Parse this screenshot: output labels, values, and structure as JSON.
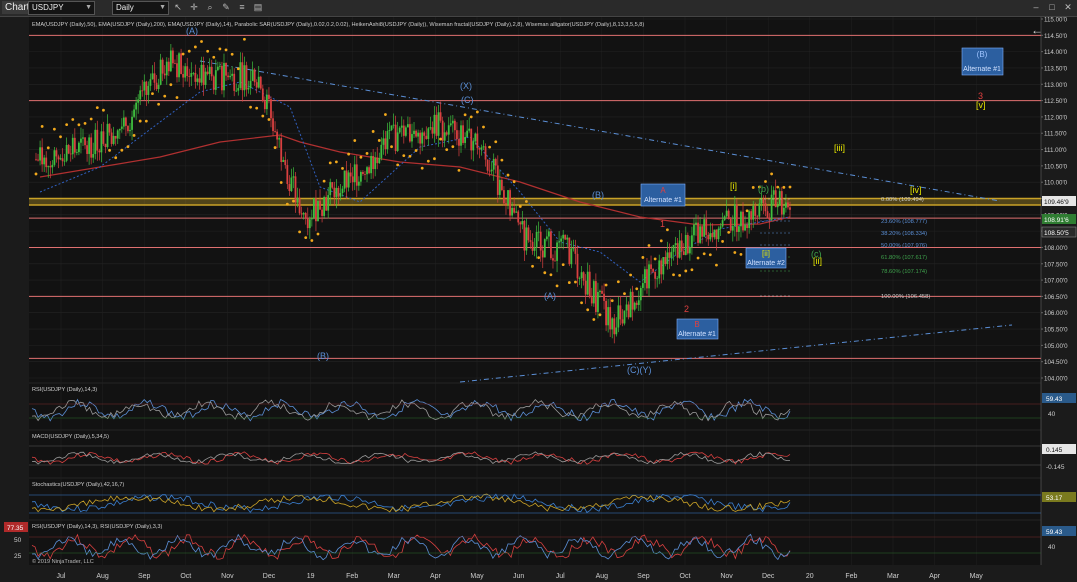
{
  "window": {
    "tab_label": "Chart",
    "instrument": "USDJPY",
    "timeframe": "Daily",
    "icons": [
      "chevron-down-icon",
      "chevron-down-icon",
      "cursor-icon",
      "crosshair-icon",
      "zoom-icon",
      "drawing-icon",
      "properties-icon",
      "strategy-icon",
      "window-minimize-icon",
      "window-maximize-icon",
      "close-icon"
    ],
    "back_arrow": "←",
    "copyright": "© 2019 NinjaTrader, LLC"
  },
  "indicator_legend": "EMA(USDJPY (Daily),50), EMA(USDJPY (Daily),200), EMA(USDJPY (Daily),14), Parabolic SAR(USDJPY (Daily),0.02,0.2,0.02), HeikenAshi8(USDJPY (Daily)), Wiseman fractal(USDJPY (Daily),2,8), Wiseman alligator(USDJPY (Daily),8,13,3,5,5,8)",
  "price_axis": {
    "ticks": [
      "115.00'0",
      "114.50'0",
      "114.00'0",
      "113.50'0",
      "113.00'0",
      "112.50'0",
      "112.00'0",
      "111.50'0",
      "111.00'0",
      "110.50'0",
      "110.00'0",
      "109.50'0",
      "109.00'0",
      "108.50'0",
      "108.00'0",
      "107.50'0",
      "107.00'0",
      "106.50'0",
      "106.00'0",
      "105.50'0",
      "105.00'0",
      "104.50'0",
      "104.00'0"
    ],
    "price_box": "109.46'9",
    "box_1": "108.91'6",
    "box_2": "108.50'5"
  },
  "time_axis": [
    "Jul",
    "Aug",
    "Sep",
    "Oct",
    "Nov",
    "Dec",
    "19",
    "Feb",
    "Mar",
    "Apr",
    "May",
    "Jun",
    "Jul",
    "Aug",
    "Sep",
    "Oct",
    "Nov",
    "Dec",
    "20",
    "Feb",
    "Mar",
    "Apr",
    "May"
  ],
  "fib_levels": [
    {
      "label": "0.00% (109.494)",
      "color": "#cccccc"
    },
    {
      "label": "23.60% (108.777)",
      "color": "#5b8fd6"
    },
    {
      "label": "38.20% (108.334)",
      "color": "#5b8fd6"
    },
    {
      "label": "50.00% (107.976)",
      "color": "#5b8fd6"
    },
    {
      "label": "61.80% (107.617)",
      "color": "#3fa34d"
    },
    {
      "label": "78.60% (107.174)",
      "color": "#3fa34d"
    },
    {
      "label": "100.00% (106.458)",
      "color": "#cccccc"
    }
  ],
  "wave_labels": {
    "A_top": "(A)",
    "X": "(X)",
    "C": "(C)",
    "B_low": "(B)",
    "B_mid": "(B)",
    "A_mid": "(A)",
    "CY": "(C)(Y)",
    "one": "1",
    "two": "2",
    "three": "3",
    "i": "[i]",
    "ii": "[ii]",
    "iii": "[iii]",
    "iv": "[iv]",
    "v": "[v]",
    "b_small": "(b)",
    "c_small": "(c)",
    "ii_small": "[ii]"
  },
  "alternate_boxes": {
    "alt1_top_label": "(B)",
    "alt1_top_text": "Alternate #1",
    "alt1_mid_label": "A",
    "alt1_mid_text": "Alternate #1",
    "alt1_low_label": "B",
    "alt1_low_text": "Alternate #1",
    "alt2_label": "[ii]",
    "alt2_text": "Alternate #2"
  },
  "panels": {
    "rsi": {
      "title": "RSI(USDJPY (Daily),14,3)",
      "value": "59.43",
      "ticks": [
        "40"
      ]
    },
    "macd": {
      "title": "MACD(USDJPY (Daily),5,34,5)",
      "value": "0.145",
      "ticks": [
        "-0.145"
      ]
    },
    "stoch": {
      "title": "Stochastics(USDJPY (Daily),42,16,7)",
      "value": "53.17"
    },
    "rsi2": {
      "title": "RSI(USDJPY (Daily),14,3), RSI(USDJPY (Daily),3,3)",
      "value": "59.43",
      "left_value": "77.35",
      "ticks": [
        "40"
      ],
      "left_ticks": [
        "50",
        "25"
      ]
    }
  },
  "chart_data": {
    "type": "line",
    "title": "",
    "xlabel": "",
    "ylabel": "",
    "ylim": [
      104.0,
      115.0
    ],
    "horizontal_levels": [
      114.5,
      112.5,
      109.5,
      109.3,
      108.9,
      108.0,
      106.5,
      104.6
    ],
    "x": [
      "Jul",
      "Aug",
      "Sep",
      "Oct",
      "Nov",
      "Dec",
      "19",
      "Feb",
      "Mar",
      "Apr",
      "May",
      "Jun",
      "Jul",
      "Aug",
      "Sep",
      "Oct",
      "Nov",
      "Dec"
    ],
    "series": [
      {
        "values": [
          110.7,
          111.0,
          111.8,
          113.7,
          113.2,
          113.3,
          108.9,
          110.0,
          111.3,
          111.8,
          111.2,
          108.3,
          107.9,
          105.6,
          107.4,
          108.5,
          109.0,
          109.5
        ]
      }
    ]
  }
}
